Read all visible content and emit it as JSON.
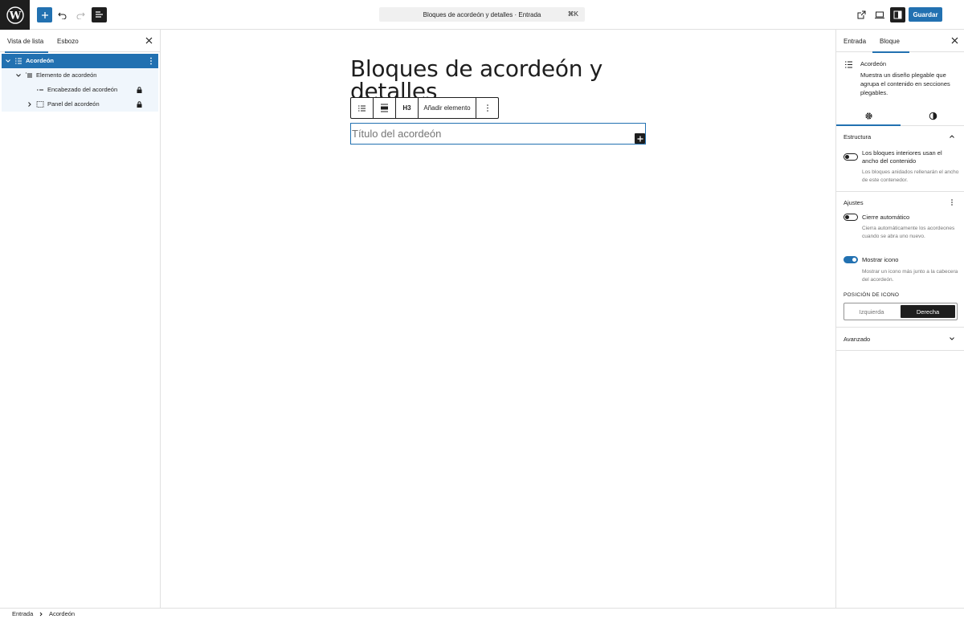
{
  "topbar": {
    "command_title": "Bloques de acordeón y detalles · Entrada",
    "command_shortcut": "⌘K",
    "save_label": "Guardar"
  },
  "left_sidebar": {
    "tab_list": "Vista de lista",
    "tab_outline": "Esbozo",
    "tree": [
      {
        "label": "Acordeón",
        "level": 0,
        "selected": true
      },
      {
        "label": "Elemento de acordeón",
        "level": 1
      },
      {
        "label": "Encabezado del acordeón",
        "level": 2,
        "locked": true
      },
      {
        "label": "Panel del acordeón",
        "level": 2,
        "locked": true
      }
    ]
  },
  "canvas": {
    "post_title": "Bloques de acordeón y detalles",
    "toolbar": {
      "heading_level": "H3",
      "add_item": "Añadir elemento"
    },
    "accordion_title_placeholder": "Título del acordeón"
  },
  "right_sidebar": {
    "tab_post": "Entrada",
    "tab_block": "Bloque",
    "block_name": "Acordeón",
    "block_desc": "Muestra un diseño plegable que agrupa el contenido en secciones plegables.",
    "structure": {
      "title": "Estructura",
      "toggle_label": "Los bloques interiores usan el ancho del contenido",
      "toggle_help": "Los bloques anidados rellenarán el ancho de este contenedor.",
      "toggle_on": false
    },
    "settings": {
      "title": "Ajustes",
      "auto_close_label": "Cierre automático",
      "auto_close_help": "Cierra automáticamente los acordeones cuando se abra uno nuevo.",
      "auto_close_on": false,
      "show_icon_label": "Mostrar icono",
      "show_icon_help": "Mostrar un icono más junto a la cabecera del acordeón.",
      "show_icon_on": true,
      "icon_position_label": "POSICIÓN DE ICONO",
      "icon_position_left": "Izquierda",
      "icon_position_right": "Derecha",
      "icon_position_selected": "Derecha"
    },
    "advanced_title": "Avanzado"
  },
  "footer": {
    "crumb_post": "Entrada",
    "crumb_block": "Acordeón"
  },
  "colors": {
    "accent": "#2271b1",
    "dark": "#1e1e1e",
    "border": "#e0e0e0",
    "muted": "#757575"
  }
}
